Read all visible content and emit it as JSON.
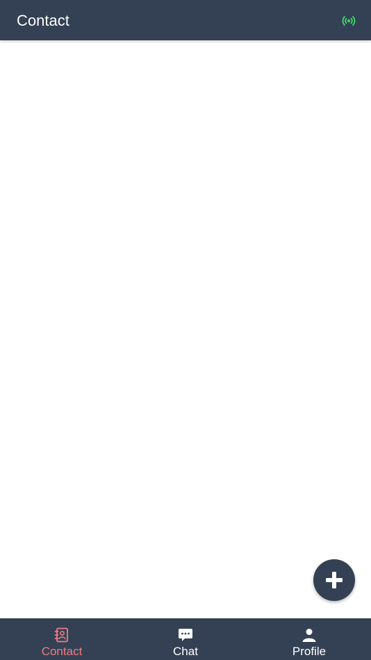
{
  "app_bar": {
    "title": "Contact",
    "status_icon": "connection-broadcast-icon",
    "status_color": "#3ddc6a"
  },
  "fab": {
    "icon": "plus-icon"
  },
  "bottom_nav": {
    "active": "contact",
    "active_color": "#f07c84",
    "items": [
      {
        "id": "contact",
        "label": "Contact",
        "icon": "address-book-icon"
      },
      {
        "id": "chat",
        "label": "Chat",
        "icon": "chat-bubble-icon"
      },
      {
        "id": "profile",
        "label": "Profile",
        "icon": "person-icon"
      }
    ]
  },
  "colors": {
    "primary": "#344154",
    "background": "#ffffff",
    "on_primary": "#ffffff"
  }
}
